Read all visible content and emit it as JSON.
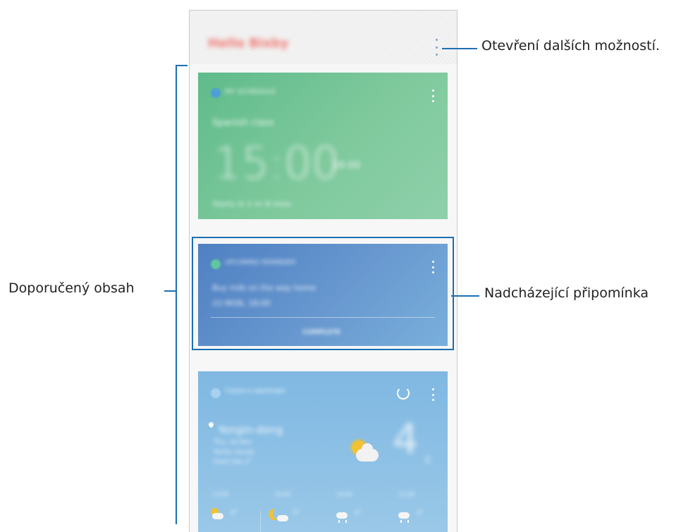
{
  "app": {
    "greeting": "Hello Bixby"
  },
  "cards": {
    "schedule": {
      "header": "MY SCHEDULE",
      "title": "Spanish class",
      "time": "15:00",
      "end_time": "16:00",
      "starts_in": "Starts in 1 hr 8 mins"
    },
    "reminder": {
      "header": "UPCOMING REMINDER",
      "text": "Buy milk on the way home",
      "date": "23 MON, 18:00",
      "action_label": "COMPLETE"
    },
    "weather": {
      "header": "TODAY'S WEATHER",
      "location": "Yongin-dong",
      "line1": "Thu, 24 Nov",
      "line2": "Partly cloudy",
      "line3": "Feels like 2°",
      "temperature": "4",
      "unit": "c",
      "hourly": [
        {
          "time": "13:00",
          "temp": "4°"
        },
        {
          "time": "16:00",
          "temp": "3°"
        },
        {
          "time": "19:00",
          "temp": "2°"
        },
        {
          "time": "22:00",
          "temp": "2°"
        }
      ]
    }
  },
  "callouts": {
    "more_options": "Otevření dalších možností.",
    "recommended": "Doporučený obsah",
    "upcoming_reminder": "Nadcházející připomínka"
  },
  "colors": {
    "callout_line": "#1c6fb2",
    "schedule_card": "#6fc396",
    "reminder_card": "#5a8cc8",
    "weather_card": "#87bde4",
    "greeting": "#f07a74"
  }
}
